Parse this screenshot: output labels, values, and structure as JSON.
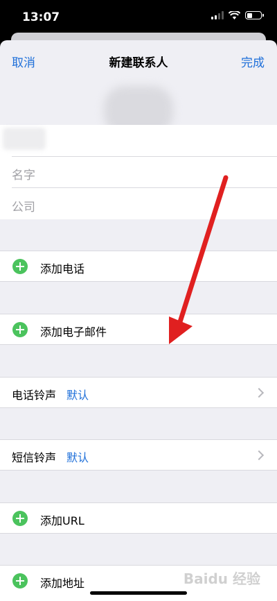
{
  "status_bar": {
    "time": "13:07"
  },
  "nav": {
    "cancel_label": "取消",
    "title": "新建联系人",
    "done_label": "完成"
  },
  "fields": {
    "first_name_placeholder": "名字",
    "company_placeholder": "公司"
  },
  "rows": {
    "add_phone": "添加电话",
    "add_email": "添加电子邮件",
    "ringtone_label": "电话铃声",
    "ringtone_value": "默认",
    "text_tone_label": "短信铃声",
    "text_tone_value": "默认",
    "add_url": "添加URL",
    "add_address": "添加地址"
  },
  "watermark": "Baidu 经验",
  "colors": {
    "accent": "#1e6fd9",
    "add_green": "#4bc35d",
    "background": "#efeff4",
    "annotation_arrow": "#e02020"
  }
}
